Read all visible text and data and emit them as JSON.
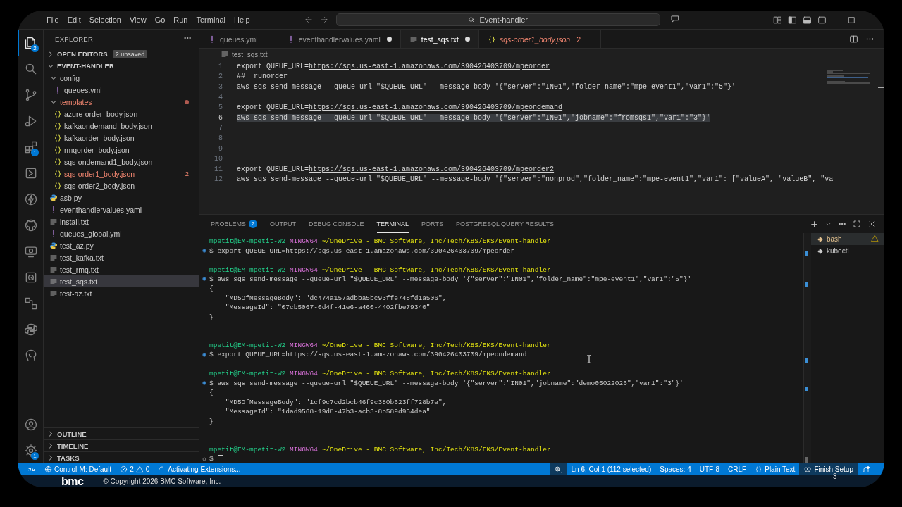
{
  "title_bar": {
    "menu": [
      "File",
      "Edit",
      "Selection",
      "View",
      "Go",
      "Run",
      "Terminal",
      "Help"
    ],
    "search": "Event-handler"
  },
  "activity_bar": {
    "items": [
      {
        "selected": true,
        "badge": "2"
      },
      {
        "selected": false
      },
      {
        "selected": false
      },
      {
        "selected": false
      },
      {
        "selected": false,
        "badge": "1"
      },
      {
        "selected": false
      },
      {
        "selected": false
      },
      {
        "selected": false
      },
      {
        "selected": false
      },
      {
        "selected": false
      },
      {
        "selected": false
      },
      {
        "selected": false
      },
      {
        "selected": false
      }
    ],
    "bottom": [
      {
        "selected": false
      },
      {
        "selected": false,
        "badge": "1"
      }
    ]
  },
  "sidebar": {
    "title": "EXPLORER",
    "open_editors": {
      "label": "OPEN EDITORS",
      "expanded": false,
      "badge": "2 unsaved"
    },
    "folder": {
      "label": "EVENT-HANDLER",
      "expanded": true,
      "tree": [
        {
          "name": "config",
          "kind": "folder",
          "expanded": true,
          "selected": false,
          "has_errors": false,
          "children": [
            {
              "name": "queues.yml",
              "kind": "yaml",
              "selected": false,
              "has_errors": false
            }
          ]
        },
        {
          "name": "templates",
          "kind": "folder",
          "expanded": true,
          "selected": false,
          "has_errors": true,
          "children": [
            {
              "name": "azure-order_body.json",
              "kind": "json",
              "selected": false,
              "has_errors": false
            },
            {
              "name": "kafkaondemand_body.json",
              "kind": "json",
              "selected": false,
              "has_errors": false
            },
            {
              "name": "kafkaorder_body.json",
              "kind": "json",
              "selected": false,
              "has_errors": false
            },
            {
              "name": "rmqorder_body.json",
              "kind": "json",
              "selected": false,
              "has_errors": false
            },
            {
              "name": "sqs-ondemand1_body.json",
              "kind": "json",
              "selected": false,
              "has_errors": false
            },
            {
              "name": "sqs-order1_body.json",
              "kind": "json",
              "selected": false,
              "has_errors": true,
              "badge": "2"
            },
            {
              "name": "sqs-order2_body.json",
              "kind": "json",
              "selected": false,
              "has_errors": false
            }
          ]
        },
        {
          "name": "asb.py",
          "kind": "python",
          "selected": false,
          "has_errors": false
        },
        {
          "name": "eventhandlervalues.yaml",
          "kind": "yaml",
          "selected": false,
          "has_errors": false
        },
        {
          "name": "install.txt",
          "kind": "text",
          "selected": false,
          "has_errors": false
        },
        {
          "name": "queues_global.yml",
          "kind": "yaml",
          "selected": false,
          "has_errors": false
        },
        {
          "name": "test_az.py",
          "kind": "python",
          "selected": false,
          "has_errors": false
        },
        {
          "name": "test_kafka.txt",
          "kind": "text",
          "selected": false,
          "has_errors": false
        },
        {
          "name": "test_rmq.txt",
          "kind": "text",
          "selected": false,
          "has_errors": false
        },
        {
          "name": "test_sqs.txt",
          "kind": "text",
          "selected": true,
          "has_errors": false
        },
        {
          "name": "test-az.txt",
          "kind": "text",
          "selected": false,
          "has_errors": false
        }
      ]
    },
    "sections": [
      {
        "label": "OUTLINE",
        "expanded": false
      },
      {
        "label": "TIMELINE",
        "expanded": false
      },
      {
        "label": "TASKS",
        "expanded": false
      }
    ]
  },
  "editor": {
    "tabs": [
      {
        "label": "queues.yml",
        "kind": "yaml",
        "selected": false,
        "modified": false,
        "has_errors": false,
        "preview": false
      },
      {
        "label": "eventhandlervalues.yaml",
        "kind": "yaml",
        "selected": false,
        "modified": true,
        "has_errors": false,
        "preview": false
      },
      {
        "label": "test_sqs.txt",
        "kind": "text",
        "selected": true,
        "modified": true,
        "has_errors": false,
        "preview": false
      },
      {
        "label": "sqs-order1_body.json",
        "kind": "json",
        "selected": false,
        "modified": false,
        "has_errors": true,
        "preview": true,
        "badge": "2"
      }
    ],
    "breadcrumb": "test_sqs.txt",
    "lines": [
      {
        "number": "1",
        "text": "export QUEUE_URL=",
        "link": "https://sqs.us-east-1.amazonaws.com/390426403709/mpeorder",
        "selected": false
      },
      {
        "number": "2",
        "text": "##  runorder",
        "selected": false
      },
      {
        "number": "3",
        "text": "aws sqs send-message --queue-url \"$QUEUE_URL\" --message-body '{\"server\":\"IN01\",\"folder_name\":\"mpe-event1\",\"var1\":\"5\"}'",
        "selected": false
      },
      {
        "number": "4",
        "selected": false
      },
      {
        "number": "5",
        "text": "export QUEUE_URL=",
        "link": "https://sqs.us-east-1.amazonaws.com/390426403709/mpeondemand",
        "selected": false
      },
      {
        "number": "6",
        "text": "aws sqs send-message --queue-url \"$QUEUE_URL\" --message-body '{\"server\":\"IN01\",\"jobname\":\"fromsqs1\",\"var1\":\"3\"}'",
        "selected": true
      },
      {
        "number": "7",
        "selected": false
      },
      {
        "number": "8",
        "selected": false
      },
      {
        "number": "9",
        "selected": false
      },
      {
        "number": "10",
        "selected": false
      },
      {
        "number": "11",
        "text": "export QUEUE_URL=",
        "link": "https://sqs.us-east-1.amazonaws.com/390426403709/mpeorder2",
        "selected": false
      },
      {
        "number": "12",
        "text": "aws sqs send-message --queue-url \"$QUEUE_URL\" --message-body '{\"server\":\"nonprod\",\"folder_name\":\"mpe-event1\",\"var1\": [\"valueA\", \"valueB\", \"va",
        "selected": false
      }
    ]
  },
  "panel": {
    "tabs": [
      {
        "label": "PROBLEMS",
        "badge": "2",
        "selected": false
      },
      {
        "label": "OUTPUT",
        "selected": false
      },
      {
        "label": "DEBUG CONSOLE",
        "selected": false
      },
      {
        "label": "TERMINAL",
        "selected": true
      },
      {
        "label": "PORTS",
        "selected": false
      },
      {
        "label": "POSTGRESQL QUERY RESULTS",
        "selected": false
      }
    ],
    "terminal": [
      {
        "kind": "prompt",
        "user": "mpetit@EM-mpetit-W2",
        "shell": "MINGW64",
        "path": "~/OneDrive - BMC Software, Inc/Tech/K8S/EKS/Event-handler"
      },
      {
        "kind": "command",
        "succeeded": true,
        "text": "$ export QUEUE_URL=https://sqs.us-east-1.amazonaws.com/390426403709/mpeorder"
      },
      {
        "kind": "blank"
      },
      {
        "kind": "prompt",
        "user": "mpetit@EM-mpetit-W2",
        "shell": "MINGW64",
        "path": "~/OneDrive - BMC Software, Inc/Tech/K8S/EKS/Event-handler"
      },
      {
        "kind": "command",
        "succeeded": true,
        "text": "$ aws sqs send-message --queue-url \"$QUEUE_URL\" --message-body '{\"server\":\"IN01\",\"folder_name\":\"mpe-event1\",\"var1\":\"5\"}'"
      },
      {
        "kind": "output",
        "text": "{"
      },
      {
        "kind": "output",
        "text": "    \"MD5OfMessageBody\": \"dc474a157adbba5bc93ffe748fd1a506\","
      },
      {
        "kind": "output",
        "text": "    \"MessageId\": \"07cb5067-0d4f-41e6-a460-4402fbe79340\""
      },
      {
        "kind": "output",
        "text": "}"
      },
      {
        "kind": "blank"
      },
      {
        "kind": "blank"
      },
      {
        "kind": "prompt",
        "user": "mpetit@EM-mpetit-W2",
        "shell": "MINGW64",
        "path": "~/OneDrive - BMC Software, Inc/Tech/K8S/EKS/Event-handler"
      },
      {
        "kind": "command",
        "succeeded": true,
        "text": "$ export QUEUE_URL=https://sqs.us-east-1.amazonaws.com/390426403709/mpeondemand"
      },
      {
        "kind": "blank"
      },
      {
        "kind": "prompt",
        "user": "mpetit@EM-mpetit-W2",
        "shell": "MINGW64",
        "path": "~/OneDrive - BMC Software, Inc/Tech/K8S/EKS/Event-handler"
      },
      {
        "kind": "command",
        "succeeded": true,
        "text": "$ aws sqs send-message --queue-url \"$QUEUE_URL\" --message-body '{\"server\":\"IN01\",\"jobname\":\"demo05022026\",\"var1\":\"3\"}'"
      },
      {
        "kind": "output",
        "text": "{"
      },
      {
        "kind": "output",
        "text": "    \"MD5OfMessageBody\": \"1cf9c7cd2bcb46f9c380b623ff728b7e\","
      },
      {
        "kind": "output",
        "text": "    \"MessageId\": \"1dad9568-19d8-47b3-acb3-8b589d954dea\""
      },
      {
        "kind": "output",
        "text": "}"
      },
      {
        "kind": "blank"
      },
      {
        "kind": "blank"
      },
      {
        "kind": "prompt",
        "user": "mpetit@EM-mpetit-W2",
        "shell": "MINGW64",
        "path": "~/OneDrive - BMC Software, Inc/Tech/K8S/EKS/Event-handler"
      },
      {
        "kind": "command",
        "succeeded": false,
        "text": "$",
        "cursor": true
      }
    ],
    "sessions": [
      {
        "label": "bash",
        "selected": true,
        "warning": true
      },
      {
        "label": "kubectl",
        "selected": false,
        "warning": false
      }
    ]
  },
  "status_bar": {
    "left": [
      {
        "kind": "remote"
      },
      {
        "kind": "profile",
        "label": "Control-M: Default"
      },
      {
        "kind": "problems",
        "errors": "2",
        "warnings": "0"
      },
      {
        "kind": "progress",
        "label": "Activating Extensions..."
      }
    ],
    "right": [
      {
        "kind": "zoom"
      },
      {
        "kind": "text",
        "label": "Ln 6, Col 1 (112 selected)"
      },
      {
        "kind": "text",
        "label": "Spaces: 4"
      },
      {
        "kind": "text",
        "label": "UTF-8"
      },
      {
        "kind": "text",
        "label": "CRLF"
      },
      {
        "kind": "language",
        "label": "Plain Text"
      },
      {
        "kind": "setup",
        "label": "Finish Setup"
      },
      {
        "kind": "bell"
      }
    ]
  },
  "footer": {
    "logo": "bmc",
    "copyright": "© Copyright 2026 BMC Software, Inc.",
    "page": "3"
  }
}
